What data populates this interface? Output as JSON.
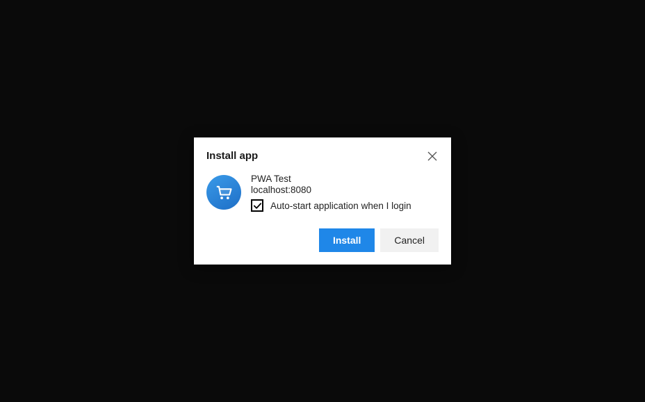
{
  "dialog": {
    "title": "Install app",
    "app_name": "PWA Test",
    "app_origin": "localhost:8080",
    "autostart_label": "Auto-start application when I login",
    "autostart_checked": true,
    "install_label": "Install",
    "cancel_label": "Cancel",
    "icon_name": "shopping-cart-icon",
    "colors": {
      "primary": "#1f87e8",
      "icon_bg_top": "#3a9ae8",
      "icon_bg_bottom": "#1e6fc7"
    }
  }
}
